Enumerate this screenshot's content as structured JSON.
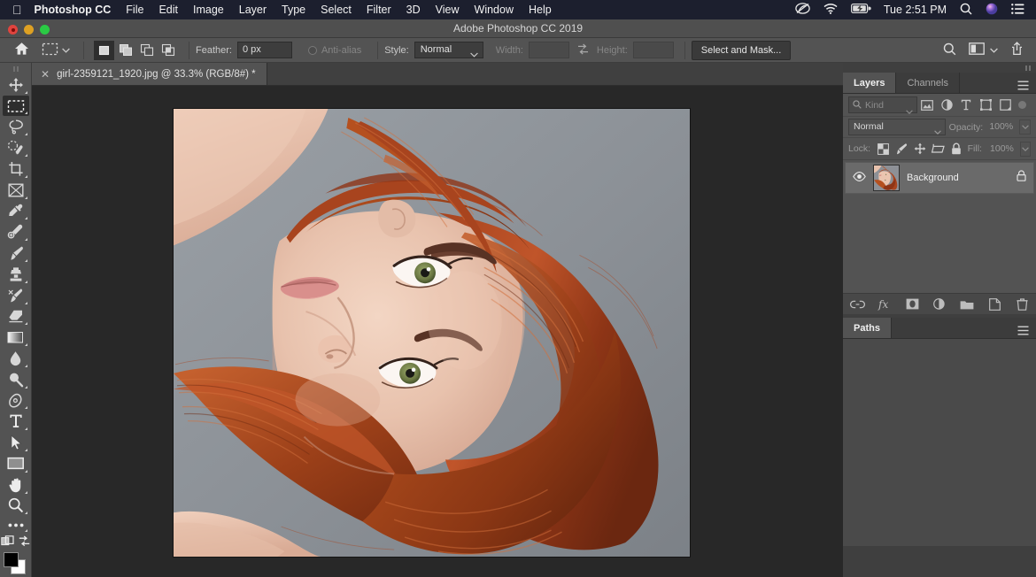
{
  "macbar": {
    "apple_icon": "apple-logo-icon",
    "app_name": "Photoshop CC",
    "menus": [
      "File",
      "Edit",
      "Image",
      "Layer",
      "Type",
      "Select",
      "Filter",
      "3D",
      "View",
      "Window",
      "Help"
    ],
    "status": {
      "creative_cloud_icon": "creative-cloud-icon",
      "wifi_icon": "wifi-icon",
      "battery_icon": "battery-charging-icon",
      "clock": "Tue 2:51 PM",
      "search_icon": "spotlight-search-icon",
      "siri_icon": "siri-icon",
      "control_center_icon": "control-center-icon"
    }
  },
  "window": {
    "title": "Adobe Photoshop CC 2019",
    "close_label": "close",
    "minimize_label": "minimize",
    "zoom_label": "zoom"
  },
  "options_bar": {
    "home_icon": "home-icon",
    "tool_preset_icon": "rectangular-marquee-icon",
    "selection_modes": [
      {
        "name": "new-selection",
        "active": true
      },
      {
        "name": "add-to-selection",
        "active": false
      },
      {
        "name": "subtract-from-selection",
        "active": false
      },
      {
        "name": "intersect-with-selection",
        "active": false
      }
    ],
    "feather_label": "Feather:",
    "feather_value": "0 px",
    "antialias_label": "Anti-alias",
    "antialias_checked": false,
    "style_label": "Style:",
    "style_value": "Normal",
    "width_label": "Width:",
    "width_value": "",
    "swap_icon": "swap-width-height-icon",
    "height_label": "Height:",
    "height_value": "",
    "select_and_mask_label": "Select and Mask...",
    "search_icon": "search-icon",
    "workspace_icon": "workspace-switcher-icon",
    "chevron_icon": "chevron-down-icon",
    "share_icon": "share-icon"
  },
  "toolbar": {
    "tools": [
      {
        "name": "move-tool",
        "active": false
      },
      {
        "name": "rectangular-marquee-tool",
        "active": true
      },
      {
        "name": "lasso-tool",
        "active": false
      },
      {
        "name": "quick-selection-tool",
        "active": false
      },
      {
        "name": "crop-tool",
        "active": false
      },
      {
        "name": "frame-tool",
        "active": false
      },
      {
        "name": "eyedropper-tool",
        "active": false
      },
      {
        "name": "spot-healing-brush-tool",
        "active": false
      },
      {
        "name": "brush-tool",
        "active": false
      },
      {
        "name": "clone-stamp-tool",
        "active": false
      },
      {
        "name": "history-brush-tool",
        "active": false
      },
      {
        "name": "eraser-tool",
        "active": false
      },
      {
        "name": "gradient-tool",
        "active": false
      },
      {
        "name": "blur-tool",
        "active": false
      },
      {
        "name": "dodge-tool",
        "active": false
      },
      {
        "name": "pen-tool",
        "active": false
      },
      {
        "name": "horizontal-type-tool",
        "active": false
      },
      {
        "name": "path-selection-tool",
        "active": false
      },
      {
        "name": "rectangle-tool",
        "active": false
      },
      {
        "name": "hand-tool",
        "active": false
      },
      {
        "name": "zoom-tool",
        "active": false
      },
      {
        "name": "edit-toolbar-tool",
        "active": false
      }
    ],
    "quick-mask-icon": "quick-mask-mode-icon",
    "screen-mode-icon": "screen-mode-icon",
    "foreground_color": "#000000",
    "background_color": "#ffffff"
  },
  "document": {
    "tab_label": "girl-2359121_1920.jpg @ 33.3% (RGB/8#) *",
    "close_icon": "close-tab-icon",
    "zoom_level": "33.3%",
    "color_mode": "RGB/8#",
    "filename": "girl-2359121_1920.jpg",
    "modified": true
  },
  "panels": {
    "tabs": [
      {
        "label": "Layers",
        "active": true
      },
      {
        "label": "Channels",
        "active": false
      }
    ],
    "menu_icon": "panel-menu-icon",
    "filter": {
      "search_icon": "search-icon",
      "kind_label": "Kind",
      "chevron_icon": "chevron-down-icon",
      "icons": [
        "filter-pixel-icon",
        "filter-adjustment-icon",
        "filter-type-icon",
        "filter-shape-icon",
        "filter-smart-object-icon"
      ],
      "toggle_name": "filter-toggle-switch"
    },
    "blend": {
      "mode_value": "Normal",
      "opacity_label": "Opacity:",
      "opacity_value": "100%",
      "chevron_icon": "chevron-down-icon"
    },
    "lock": {
      "label": "Lock:",
      "icons": [
        "lock-transparent-pixels-icon",
        "lock-image-pixels-icon",
        "lock-position-icon",
        "lock-artboard-nesting-icon",
        "lock-all-icon"
      ],
      "fill_label": "Fill:",
      "fill_value": "100%"
    },
    "layers": [
      {
        "name": "Background",
        "visible": true,
        "locked": true,
        "eye_icon": "eye-visible-icon",
        "lock_icon": "lock-icon",
        "thumbnail_name": "layer-thumbnail"
      }
    ],
    "footer_icons": [
      "link-layers-icon",
      "layer-style-fx-icon",
      "add-layer-mask-icon",
      "new-adjustment-layer-icon",
      "new-group-icon",
      "new-layer-icon",
      "delete-layer-icon"
    ],
    "paths": {
      "tab_label": "Paths",
      "menu_icon": "panel-menu-icon"
    }
  },
  "colors": {
    "menubar_bg": "#1c1f2e",
    "titlebar_bg": "#4f4f4f",
    "chrome_bg": "#535353",
    "canvas_bg": "#282828",
    "panel_bg": "#3f3f3f",
    "active_tool_bg": "#2e2e2e",
    "selected_layer_bg": "#6a6a6a",
    "text_primary": "#e0e0e0",
    "text_dim": "#8c8c8c"
  }
}
